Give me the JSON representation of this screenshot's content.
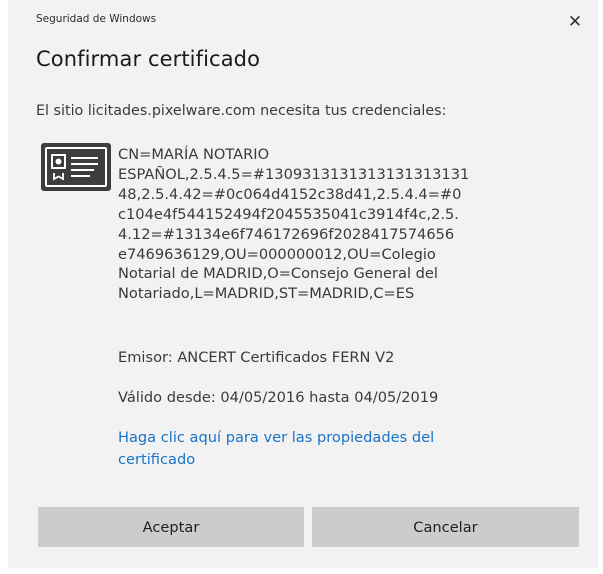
{
  "window": {
    "title": "Seguridad de Windows",
    "close_glyph": "✕",
    "icons": {
      "close": "close-icon",
      "certificate": "certificate-icon"
    }
  },
  "heading": "Confirmar certificado",
  "prompt": "El sitio licitades.pixelware.com necesita tus credenciales:",
  "certificate": {
    "subject": "CN=MARÍA NOTARIO\nESPAÑOL,2.5.4.5=#1309313131313131313131\n48,2.5.4.42=#0c064d4152c38d41,2.5.4.4=#0\nc104e4f544152494f2045535041c3914f4c,2.5.\n4.12=#13134e6f746172696f2028417574656\ne7469636129,OU=000000012,OU=Colegio\nNotarial de MADRID,O=Consejo General del\nNotariado,L=MADRID,ST=MADRID,C=ES",
    "issuer": "Emisor: ANCERT Certificados FERN V2",
    "validity": "Válido desde: 04/05/2016 hasta 04/05/2019",
    "properties_link": "Haga clic aquí para ver las propiedades del\ncertificado"
  },
  "buttons": {
    "accept": "Aceptar",
    "cancel": "Cancelar"
  },
  "colors": {
    "dialog_bg": "#f2f2f2",
    "link": "#1a73c7",
    "button_bg": "#cccccc",
    "icon_dark": "#3d3d3d"
  }
}
